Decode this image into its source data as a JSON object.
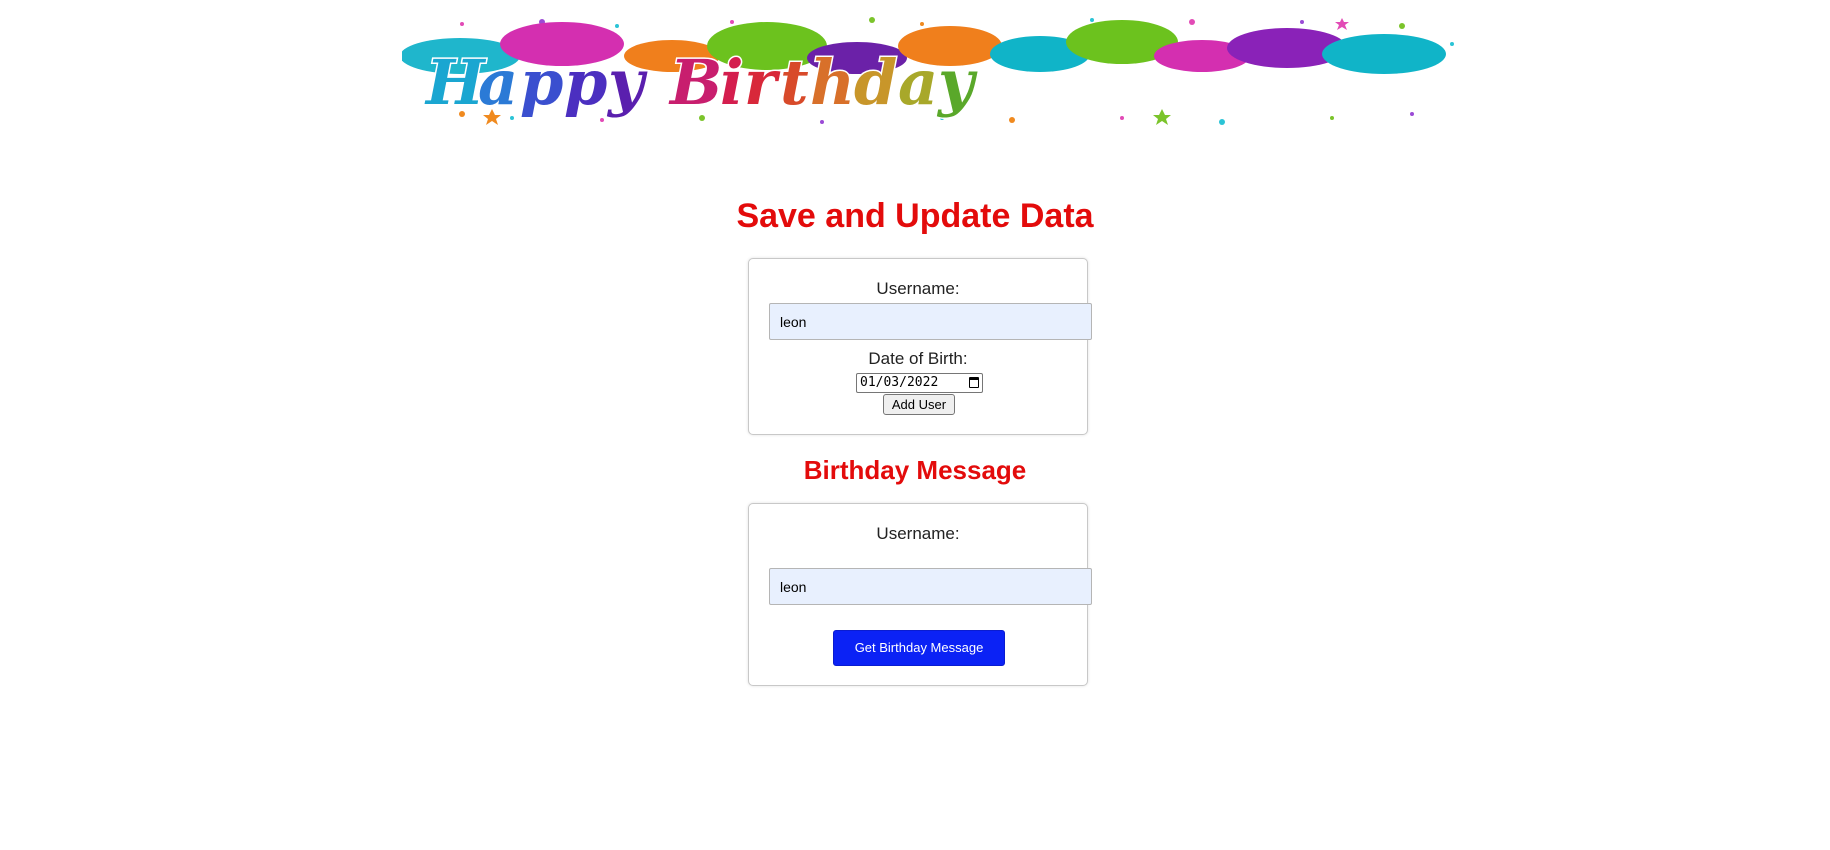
{
  "banner": {
    "text": "Happy Birthday"
  },
  "save_section": {
    "title": "Save and Update Data",
    "username_label": "Username:",
    "username_value": "leon",
    "dob_label": "Date of Birth:",
    "dob_value": "01/03/2022",
    "add_button_label": "Add User"
  },
  "message_section": {
    "title": "Birthday Message",
    "username_label": "Username:",
    "username_value": "leon",
    "get_button_label": "Get Birthday Message"
  },
  "colors": {
    "heading": "#e30b0b",
    "primary_button": "#0b22f5",
    "autofill_input": "#e8f0fe"
  },
  "icons": {
    "date_picker": "calendar-icon"
  }
}
